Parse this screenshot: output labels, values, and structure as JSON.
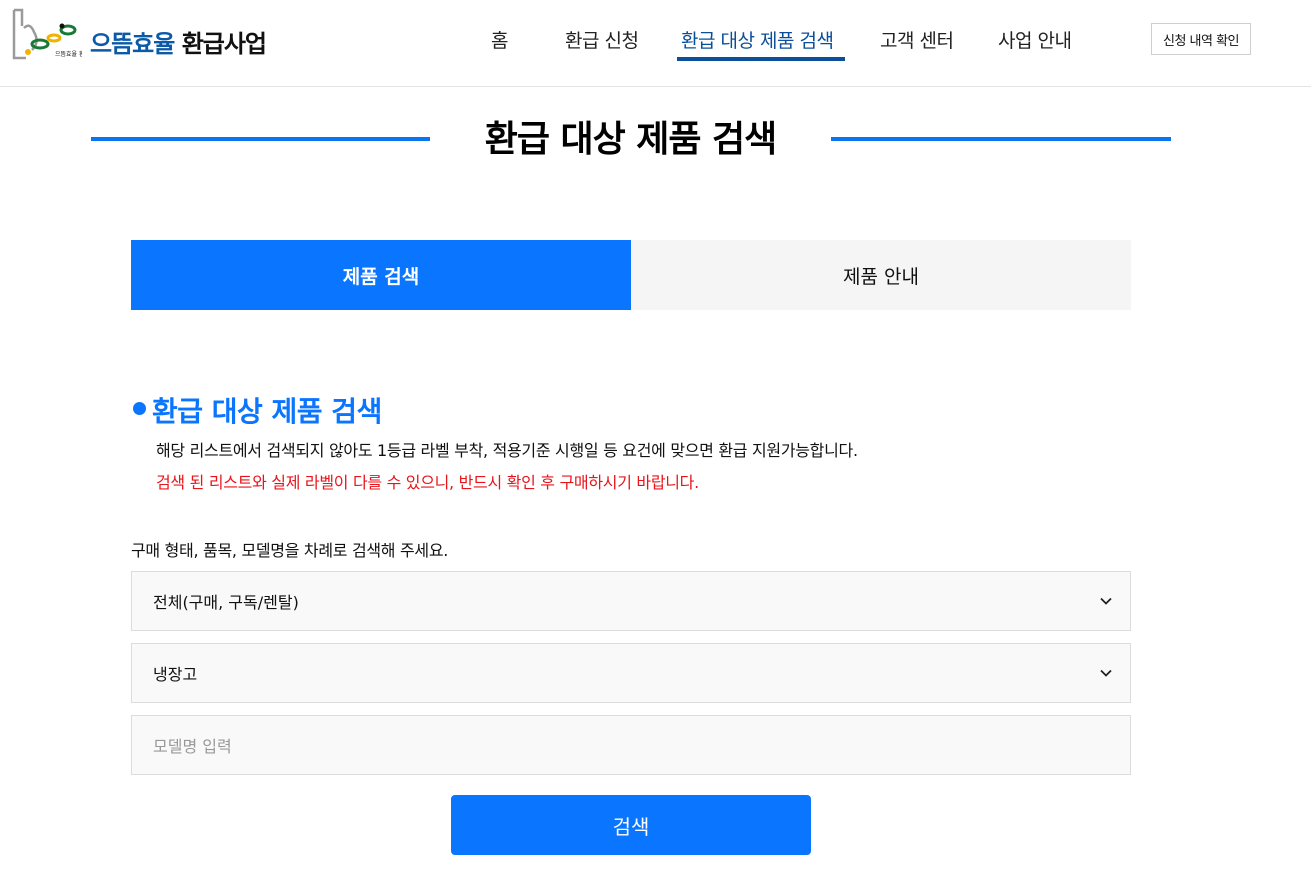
{
  "header": {
    "brand_primary": "으뜸효율",
    "brand_secondary": "환급사업",
    "logo_text": "으뜸효율 환급사업",
    "nav": [
      {
        "label": "홈"
      },
      {
        "label": "환급 신청"
      },
      {
        "label": "환급 대상 제품 검색"
      },
      {
        "label": "고객 센터"
      },
      {
        "label": "사업 안내"
      }
    ],
    "active_nav": "환급 대상 제품 검색",
    "history_button": "신청 내역 확인"
  },
  "page_title": "환급 대상 제품 검색",
  "tabs": [
    {
      "label": "제품 검색",
      "active": true
    },
    {
      "label": "제품 안내",
      "active": false
    }
  ],
  "section": {
    "title": "환급 대상 제품 검색",
    "desc": "해당 리스트에서 검색되지 않아도 1등급 라벨 부착, 적용기준 시행일 등 요건에 맞으면 환급 지원가능합니다.",
    "warning": "검색 된 리스트와 실제 라벨이 다를 수 있으니, 반드시 확인 후 구매하시기 바랍니다."
  },
  "form": {
    "instruction": "구매 형태, 품목, 모델명을 차례로 검색해 주세요.",
    "purchase_type": "전체(구매, 구독/렌탈)",
    "category": "냉장고",
    "model_placeholder": "모델명 입력",
    "search_button": "검색"
  },
  "colors": {
    "accent": "#0a75ff",
    "nav_active": "#0b4f9a",
    "warning": "#e8141b",
    "brand": "#0a5aa8"
  },
  "icons": [
    "logo-icon",
    "chevron-down-icon"
  ]
}
